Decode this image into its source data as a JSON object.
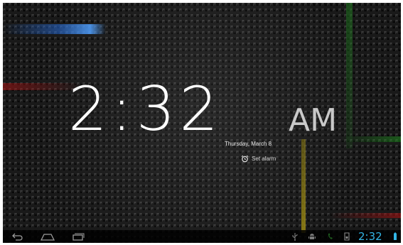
{
  "lockscreen": {
    "time": "2:32",
    "ampm": "AM",
    "date": "Thursday, March 8",
    "alarm_label": "Set alarm"
  },
  "status_bar": {
    "time": "2:32"
  },
  "nav_bar": {
    "buttons": [
      "back-icon",
      "home-icon",
      "recent-apps-icon"
    ]
  },
  "icons": [
    "alarm-clock-icon",
    "usb-icon",
    "android-debug-icon",
    "phone-icon",
    "sd-card-icon",
    "battery-icon"
  ],
  "colors": {
    "status_time": "#33b5e5",
    "clock_text": "#ffffff",
    "ampm_text": "#c9c9c9"
  }
}
